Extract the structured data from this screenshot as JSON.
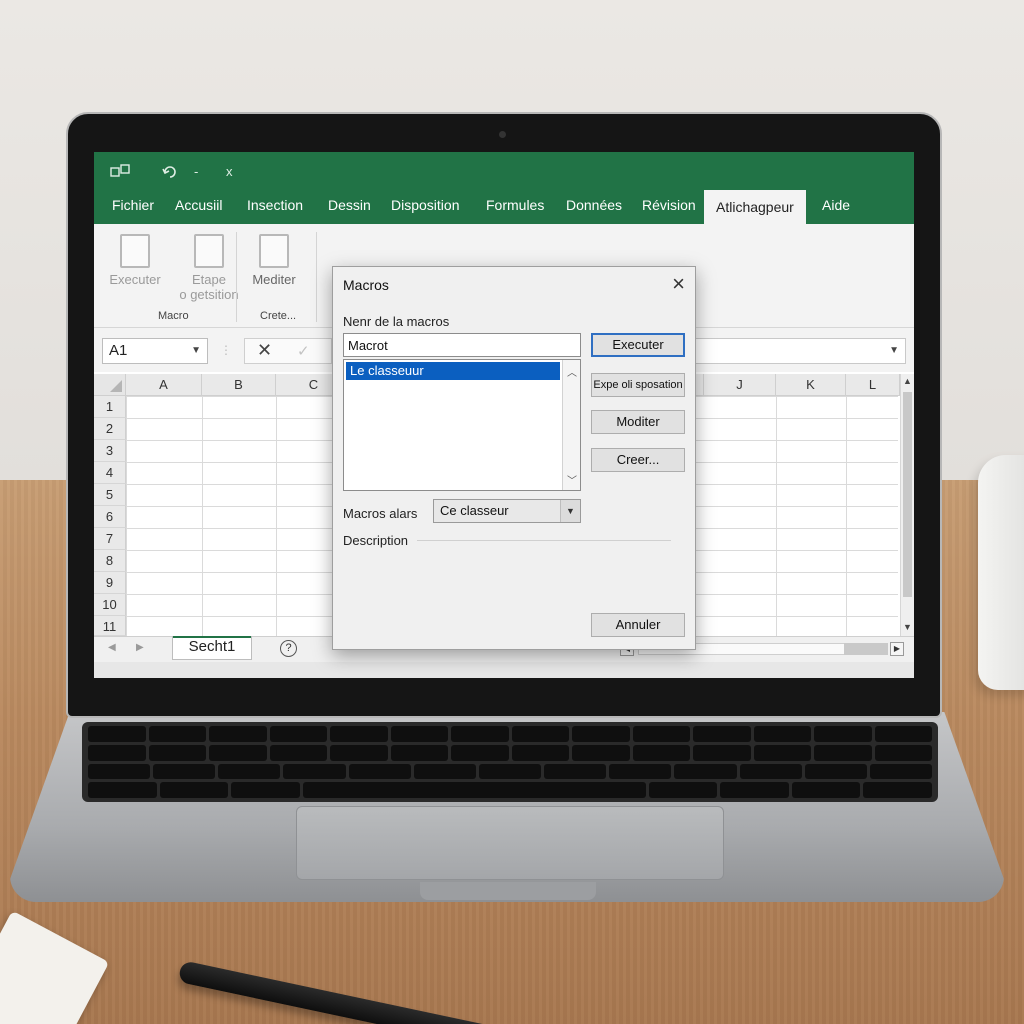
{
  "quick_access": {
    "save_icon": "save-icon",
    "undo_icon": "undo-icon",
    "dash": "-",
    "close_glyph": "x"
  },
  "ribbon_tabs": [
    "Fichier",
    "Accusiil",
    "Insection",
    "Dessin",
    "Disposition",
    "Formules",
    "Données",
    "Révision",
    "Atlichagpeur",
    "Aide"
  ],
  "active_tab_index": 8,
  "ribbon": {
    "buttons": [
      {
        "label": "Executer",
        "icon": "document-icon"
      },
      {
        "label": "Etape",
        "label2": "o getsition",
        "icon": "document-lines-icon"
      },
      {
        "label": "Mediter",
        "icon": "document-gear-icon"
      }
    ],
    "groups": [
      "Macro",
      "Crete..."
    ]
  },
  "formula_bar": {
    "cell_ref": "A1",
    "cancel_glyph": "✕",
    "enter_glyph": "✓"
  },
  "grid": {
    "columns_left": [
      "A",
      "B",
      "C"
    ],
    "columns_right": [
      "J",
      "K",
      "L"
    ],
    "rows": [
      "1",
      "2",
      "3",
      "4",
      "5",
      "6",
      "7",
      "8",
      "9",
      "10",
      "11"
    ]
  },
  "sheets": {
    "active_sheet": "Secht1",
    "add_glyph": "?"
  },
  "dialog": {
    "title": "Macros",
    "name_label": "Nenr de la macros",
    "name_value": "Macrot",
    "list_items": [
      "Le classeuur"
    ],
    "buttons": [
      "Executer",
      "Expe oli sposation",
      "Moditer",
      "Creer...",
      "Annuler"
    ],
    "macros_in_label": "Macros alars",
    "macros_in_value": "Ce classeur",
    "description_label": "Description"
  },
  "colors": {
    "excel_green": "#217346",
    "selection_blue": "#0b5fc0"
  }
}
